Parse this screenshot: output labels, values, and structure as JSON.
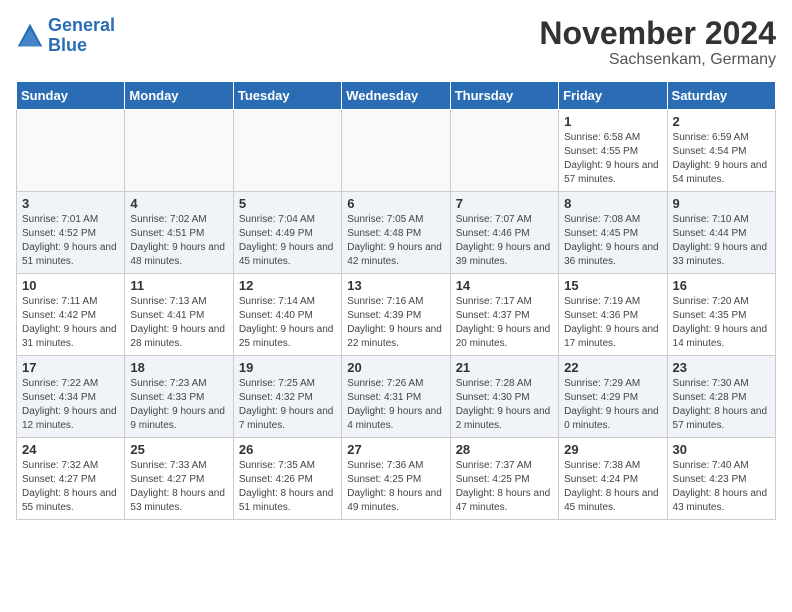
{
  "logo": {
    "line1": "General",
    "line2": "Blue"
  },
  "title": "November 2024",
  "location": "Sachsenkam, Germany",
  "days_header": [
    "Sunday",
    "Monday",
    "Tuesday",
    "Wednesday",
    "Thursday",
    "Friday",
    "Saturday"
  ],
  "weeks": [
    [
      {
        "day": "",
        "info": ""
      },
      {
        "day": "",
        "info": ""
      },
      {
        "day": "",
        "info": ""
      },
      {
        "day": "",
        "info": ""
      },
      {
        "day": "",
        "info": ""
      },
      {
        "day": "1",
        "info": "Sunrise: 6:58 AM\nSunset: 4:55 PM\nDaylight: 9 hours\nand 57 minutes."
      },
      {
        "day": "2",
        "info": "Sunrise: 6:59 AM\nSunset: 4:54 PM\nDaylight: 9 hours\nand 54 minutes."
      }
    ],
    [
      {
        "day": "3",
        "info": "Sunrise: 7:01 AM\nSunset: 4:52 PM\nDaylight: 9 hours\nand 51 minutes."
      },
      {
        "day": "4",
        "info": "Sunrise: 7:02 AM\nSunset: 4:51 PM\nDaylight: 9 hours\nand 48 minutes."
      },
      {
        "day": "5",
        "info": "Sunrise: 7:04 AM\nSunset: 4:49 PM\nDaylight: 9 hours\nand 45 minutes."
      },
      {
        "day": "6",
        "info": "Sunrise: 7:05 AM\nSunset: 4:48 PM\nDaylight: 9 hours\nand 42 minutes."
      },
      {
        "day": "7",
        "info": "Sunrise: 7:07 AM\nSunset: 4:46 PM\nDaylight: 9 hours\nand 39 minutes."
      },
      {
        "day": "8",
        "info": "Sunrise: 7:08 AM\nSunset: 4:45 PM\nDaylight: 9 hours\nand 36 minutes."
      },
      {
        "day": "9",
        "info": "Sunrise: 7:10 AM\nSunset: 4:44 PM\nDaylight: 9 hours\nand 33 minutes."
      }
    ],
    [
      {
        "day": "10",
        "info": "Sunrise: 7:11 AM\nSunset: 4:42 PM\nDaylight: 9 hours\nand 31 minutes."
      },
      {
        "day": "11",
        "info": "Sunrise: 7:13 AM\nSunset: 4:41 PM\nDaylight: 9 hours\nand 28 minutes."
      },
      {
        "day": "12",
        "info": "Sunrise: 7:14 AM\nSunset: 4:40 PM\nDaylight: 9 hours\nand 25 minutes."
      },
      {
        "day": "13",
        "info": "Sunrise: 7:16 AM\nSunset: 4:39 PM\nDaylight: 9 hours\nand 22 minutes."
      },
      {
        "day": "14",
        "info": "Sunrise: 7:17 AM\nSunset: 4:37 PM\nDaylight: 9 hours\nand 20 minutes."
      },
      {
        "day": "15",
        "info": "Sunrise: 7:19 AM\nSunset: 4:36 PM\nDaylight: 9 hours\nand 17 minutes."
      },
      {
        "day": "16",
        "info": "Sunrise: 7:20 AM\nSunset: 4:35 PM\nDaylight: 9 hours\nand 14 minutes."
      }
    ],
    [
      {
        "day": "17",
        "info": "Sunrise: 7:22 AM\nSunset: 4:34 PM\nDaylight: 9 hours\nand 12 minutes."
      },
      {
        "day": "18",
        "info": "Sunrise: 7:23 AM\nSunset: 4:33 PM\nDaylight: 9 hours\nand 9 minutes."
      },
      {
        "day": "19",
        "info": "Sunrise: 7:25 AM\nSunset: 4:32 PM\nDaylight: 9 hours\nand 7 minutes."
      },
      {
        "day": "20",
        "info": "Sunrise: 7:26 AM\nSunset: 4:31 PM\nDaylight: 9 hours\nand 4 minutes."
      },
      {
        "day": "21",
        "info": "Sunrise: 7:28 AM\nSunset: 4:30 PM\nDaylight: 9 hours\nand 2 minutes."
      },
      {
        "day": "22",
        "info": "Sunrise: 7:29 AM\nSunset: 4:29 PM\nDaylight: 9 hours\nand 0 minutes."
      },
      {
        "day": "23",
        "info": "Sunrise: 7:30 AM\nSunset: 4:28 PM\nDaylight: 8 hours\nand 57 minutes."
      }
    ],
    [
      {
        "day": "24",
        "info": "Sunrise: 7:32 AM\nSunset: 4:27 PM\nDaylight: 8 hours\nand 55 minutes."
      },
      {
        "day": "25",
        "info": "Sunrise: 7:33 AM\nSunset: 4:27 PM\nDaylight: 8 hours\nand 53 minutes."
      },
      {
        "day": "26",
        "info": "Sunrise: 7:35 AM\nSunset: 4:26 PM\nDaylight: 8 hours\nand 51 minutes."
      },
      {
        "day": "27",
        "info": "Sunrise: 7:36 AM\nSunset: 4:25 PM\nDaylight: 8 hours\nand 49 minutes."
      },
      {
        "day": "28",
        "info": "Sunrise: 7:37 AM\nSunset: 4:25 PM\nDaylight: 8 hours\nand 47 minutes."
      },
      {
        "day": "29",
        "info": "Sunrise: 7:38 AM\nSunset: 4:24 PM\nDaylight: 8 hours\nand 45 minutes."
      },
      {
        "day": "30",
        "info": "Sunrise: 7:40 AM\nSunset: 4:23 PM\nDaylight: 8 hours\nand 43 minutes."
      }
    ]
  ]
}
